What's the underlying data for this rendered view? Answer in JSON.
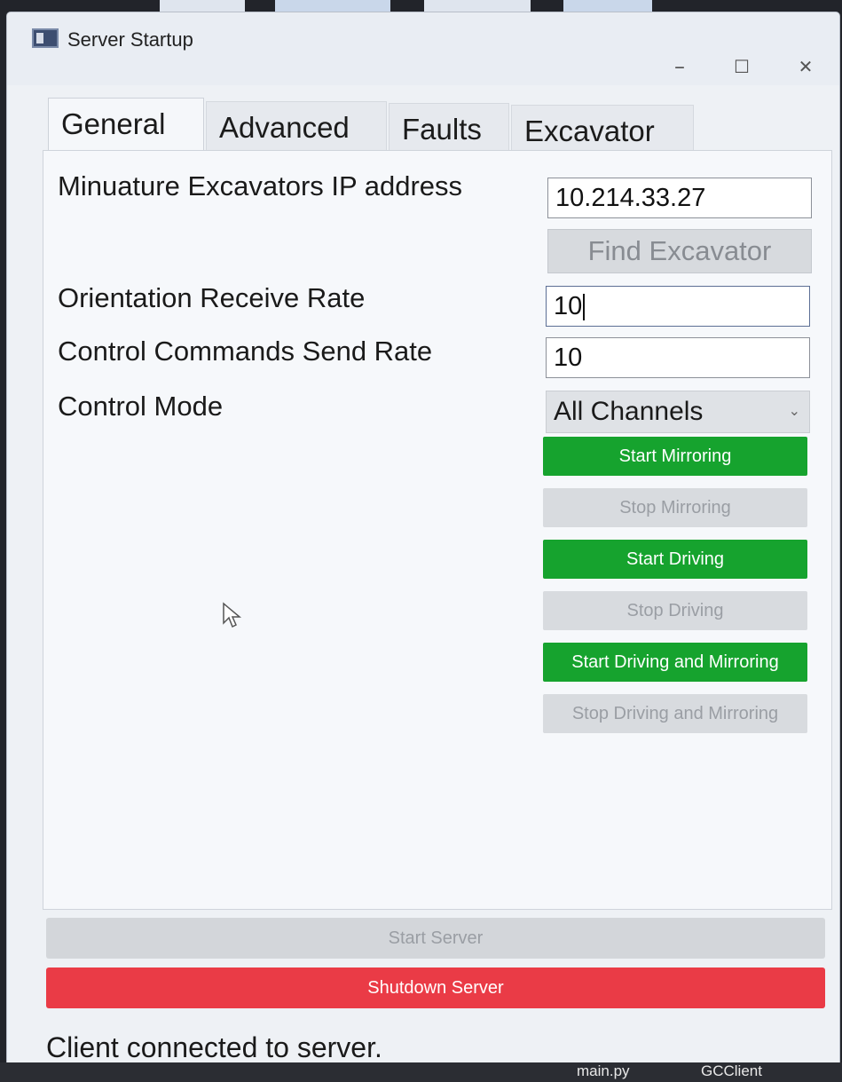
{
  "window": {
    "title": "Server Startup",
    "minimize": "–",
    "maximize": "☐",
    "close": "✕"
  },
  "tabs": [
    {
      "label": "General"
    },
    {
      "label": "Advanced"
    },
    {
      "label": "Faults"
    },
    {
      "label": "Excavator"
    }
  ],
  "form": {
    "ip_label": "Minuature Excavators IP address",
    "ip_value": "10.214.33.27",
    "find_button": "Find Excavator",
    "orientation_label": "Orientation Receive Rate",
    "orientation_value": "10",
    "control_rate_label": "Control Commands Send Rate",
    "control_rate_value": "10",
    "control_mode_label": "Control Mode",
    "control_mode_value": "All Channels"
  },
  "actions": {
    "start_mirroring": "Start Mirroring",
    "stop_mirroring": "Stop Mirroring",
    "start_driving": "Start Driving",
    "stop_driving": "Stop Driving",
    "start_driving_mirroring": "Start Driving and Mirroring",
    "stop_driving_mirroring": "Stop Driving and Mirroring"
  },
  "server": {
    "start": "Start Server",
    "shutdown": "Shutdown Server"
  },
  "status": {
    "message": "Client connected to server."
  },
  "taskbar": {
    "item1": "main.py",
    "item2": "GCClient"
  },
  "colors": {
    "enabled_green": "#16a32e",
    "disabled_gray": "#d8dbdf",
    "shutdown_red": "#ea3b46"
  }
}
